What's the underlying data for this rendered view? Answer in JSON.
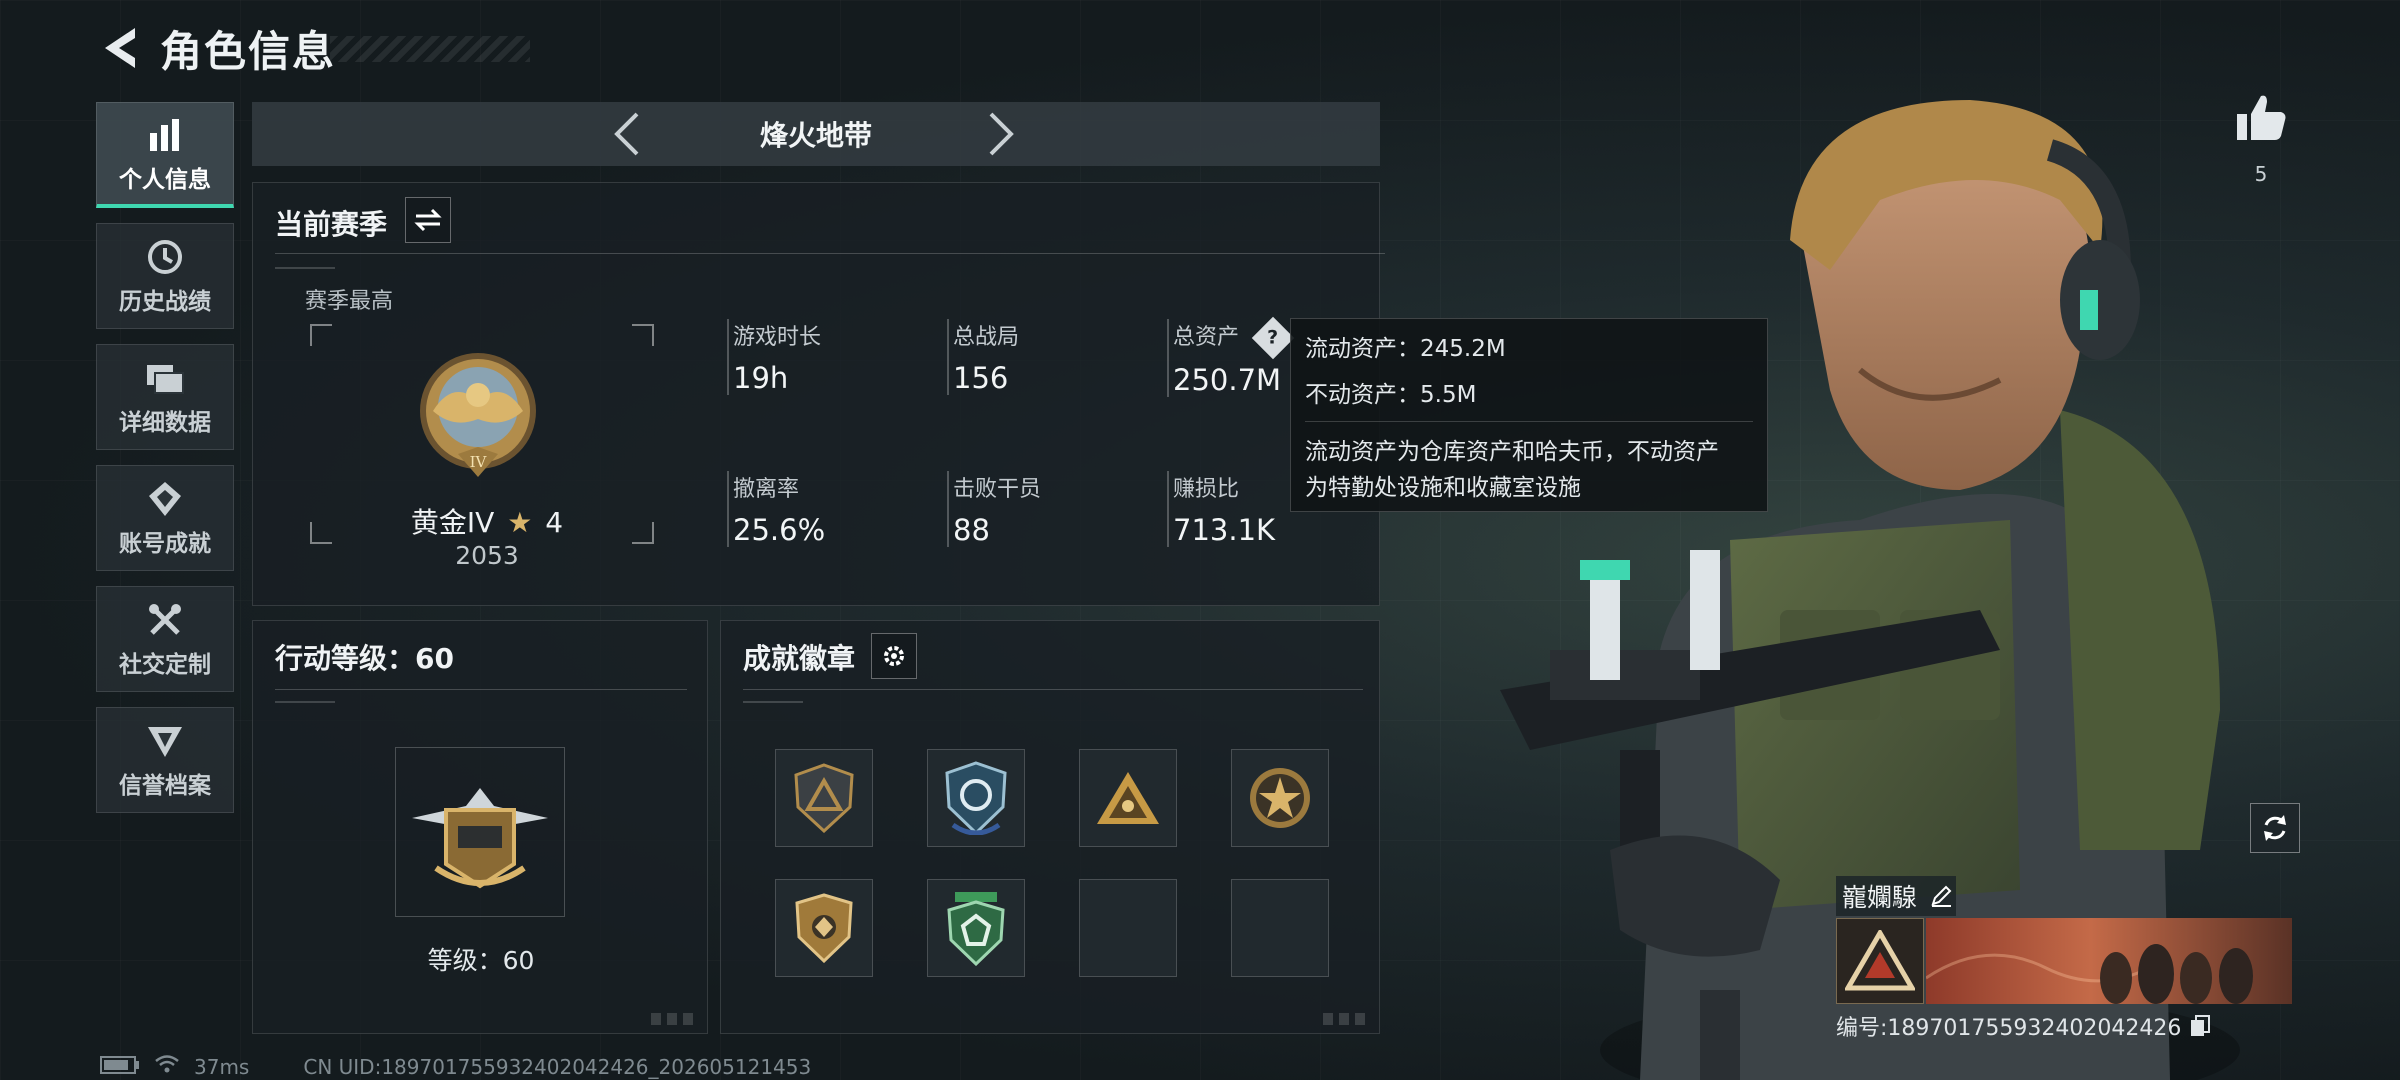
{
  "header": {
    "title": "角色信息"
  },
  "sidebar": {
    "items": [
      {
        "label": "个人信息",
        "icon": "bar-chart-icon",
        "active": true
      },
      {
        "label": "历史战绩",
        "icon": "history-icon"
      },
      {
        "label": "详细数据",
        "icon": "folder-icon"
      },
      {
        "label": "账号成就",
        "icon": "achievement-icon"
      },
      {
        "label": "社交定制",
        "icon": "tools-icon"
      },
      {
        "label": "信誉档案",
        "icon": "reputation-icon"
      }
    ]
  },
  "mode": {
    "name": "烽火地带"
  },
  "season": {
    "title": "当前赛季",
    "best_label": "赛季最高",
    "rank_name": "黄金IV",
    "rank_stars": "4",
    "rank_score": "2053",
    "stats": [
      {
        "label": "游戏时长",
        "value": "19h"
      },
      {
        "label": "总战局",
        "value": "156"
      },
      {
        "label": "总资产",
        "value": "250.7M"
      },
      {
        "label": "撤离率",
        "value": "25.6%"
      },
      {
        "label": "击败干员",
        "value": "88"
      },
      {
        "label": "赚损比",
        "value": "713.1K"
      }
    ]
  },
  "tooltip": {
    "liquid": "流动资产：245.2M",
    "fixed": "不动资产：5.5M",
    "desc_line1": "流动资产为仓库资产和哈夫币，不动资产",
    "desc_line2": "为特勤处设施和收藏室设施"
  },
  "action_level": {
    "title": "行动等级：60",
    "level_text": "等级：60"
  },
  "badges": {
    "title": "成就徽章"
  },
  "likes": {
    "count": "5"
  },
  "card": {
    "name": "巃孄騡",
    "id_text": "编号:189701755932402042426"
  },
  "status": {
    "ping": "37ms",
    "uid": "CN UID:189701755932402042426_202605121453"
  },
  "colors": {
    "accent": "#3fd7b0",
    "gold": "#c8a255"
  }
}
